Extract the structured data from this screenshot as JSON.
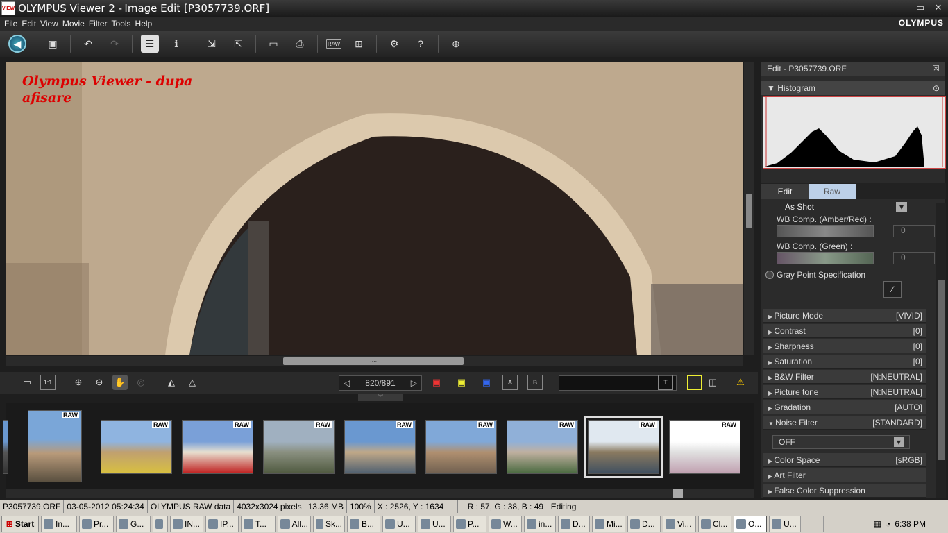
{
  "window": {
    "app_icon_text": "VIEW",
    "app_name": "OLYMPUS Viewer 2 -",
    "doc_title": "Image Edit [P3057739.ORF]",
    "min": "–",
    "max": "▭",
    "close": "✕"
  },
  "menu": [
    "File",
    "Edit",
    "View",
    "Movie",
    "Filter",
    "Tools",
    "Help"
  ],
  "brand": "OLYMPUS",
  "toolbar": {
    "raw_label": "RAW"
  },
  "viewer": {
    "watermark_line1": "Olympus Viewer - dupa",
    "watermark_line2": "afisare",
    "scroll_grip": "∙∙∙∙"
  },
  "viewbar": {
    "one_to_one": "1:1",
    "pager": "820/891",
    "prev": "◁",
    "next": "▷",
    "text_btn": "T",
    "a_btn": "A",
    "b_btn": "B",
    "collapse": "︾"
  },
  "filmstrip": {
    "raw_badge": "RAW",
    "thumbs": [
      {
        "colors": [
          "#7aa6d8",
          "#b89a7a",
          "#5a5040"
        ]
      },
      {
        "colors": [
          "#8fb4e0",
          "#c0a070",
          "#d8c040"
        ]
      },
      {
        "colors": [
          "#7aa0d8",
          "#e8e0d0",
          "#c02020"
        ]
      },
      {
        "colors": [
          "#a0b0c0",
          "#8a9080",
          "#505a40"
        ]
      },
      {
        "colors": [
          "#6a98d0",
          "#c0a888",
          "#506070"
        ]
      },
      {
        "colors": [
          "#80a8d8",
          "#b09070",
          "#706050"
        ]
      },
      {
        "colors": [
          "#90b0d8",
          "#c0b0a0",
          "#4a6a40"
        ]
      },
      {
        "colors": [
          "#e0e8f0",
          "#8a7a60",
          "#405060"
        ]
      },
      {
        "colors": [
          "#ffffff",
          "#e0e0e0",
          "#c0a0b0"
        ]
      }
    ]
  },
  "panel": {
    "title": "Edit - P3057739.ORF",
    "histogram_label": "Histogram",
    "tab_edit": "Edit",
    "tab_raw": "Raw",
    "wb_value": "As Shot",
    "wb_amber_label": "WB Comp. (Amber/Red) :",
    "wb_amber_value": "0",
    "wb_green_label": "WB Comp. (Green) :",
    "wb_green_value": "0",
    "gray_point": "Gray Point Specification",
    "rows": [
      {
        "label": "Picture Mode",
        "value": "[VIVID]"
      },
      {
        "label": "Contrast",
        "value": "[0]"
      },
      {
        "label": "Sharpness",
        "value": "[0]"
      },
      {
        "label": "Saturation",
        "value": "[0]"
      },
      {
        "label": "B&W Filter",
        "value": "[N:NEUTRAL]"
      },
      {
        "label": "Picture tone",
        "value": "[N:NEUTRAL]"
      },
      {
        "label": "Gradation",
        "value": "[AUTO]"
      },
      {
        "label": "Noise Filter",
        "value": "[STANDARD]"
      }
    ],
    "noise_select": "OFF",
    "rows2": [
      {
        "label": "Color Space",
        "value": "[sRGB]"
      },
      {
        "label": "Art Filter",
        "value": ""
      },
      {
        "label": "False Color Suppression",
        "value": ""
      }
    ]
  },
  "status": {
    "file": "P3057739.ORF",
    "date": "03-05-2012 05:24:34",
    "format": "OLYMPUS RAW data",
    "pixels": "4032x3024 pixels",
    "size": "13.36 MB",
    "zoom": "100%",
    "coords": "X : 2526, Y : 1634",
    "rgb": "R : 57, G : 38, B : 49",
    "mode": "Editing"
  },
  "taskbar": {
    "start": "Start",
    "tasks": [
      "In...",
      "Pr...",
      "G...",
      "",
      "IN...",
      "IP...",
      "T...",
      "All...",
      "Sk...",
      "B...",
      "U...",
      "U...",
      "P...",
      "W...",
      "in...",
      "D...",
      "Mi...",
      "D...",
      "Vi...",
      "Cl...",
      "O...",
      "U..."
    ],
    "active_index": 20,
    "clock": "6:38 PM"
  }
}
